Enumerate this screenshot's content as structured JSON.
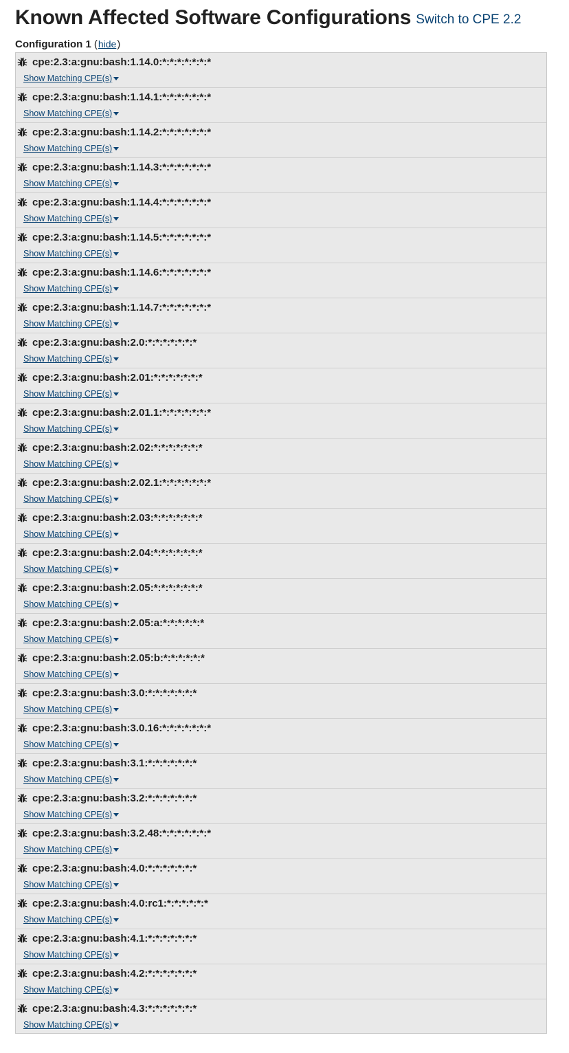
{
  "header": {
    "title": "Known Affected Software Configurations",
    "switch_link": "Switch to CPE 2.2"
  },
  "configuration": {
    "label": "Configuration 1",
    "open_paren": "(",
    "hide_link": "hide",
    "close_paren": ")"
  },
  "icons": {
    "vulnerable": "bug-icon",
    "expand": "caret-down-icon"
  },
  "colors": {
    "link": "#0a4373",
    "row_background": "#e9e9e9",
    "row_border": "#cfcfcf"
  },
  "cpe_items": [
    {
      "cpe": "cpe:2.3:a:gnu:bash:1.14.0:*:*:*:*:*:*:*",
      "match_label": "Show Matching CPE(s)"
    },
    {
      "cpe": "cpe:2.3:a:gnu:bash:1.14.1:*:*:*:*:*:*:*",
      "match_label": "Show Matching CPE(s)"
    },
    {
      "cpe": "cpe:2.3:a:gnu:bash:1.14.2:*:*:*:*:*:*:*",
      "match_label": "Show Matching CPE(s)"
    },
    {
      "cpe": "cpe:2.3:a:gnu:bash:1.14.3:*:*:*:*:*:*:*",
      "match_label": "Show Matching CPE(s)"
    },
    {
      "cpe": "cpe:2.3:a:gnu:bash:1.14.4:*:*:*:*:*:*:*",
      "match_label": "Show Matching CPE(s)"
    },
    {
      "cpe": "cpe:2.3:a:gnu:bash:1.14.5:*:*:*:*:*:*:*",
      "match_label": "Show Matching CPE(s)"
    },
    {
      "cpe": "cpe:2.3:a:gnu:bash:1.14.6:*:*:*:*:*:*:*",
      "match_label": "Show Matching CPE(s)"
    },
    {
      "cpe": "cpe:2.3:a:gnu:bash:1.14.7:*:*:*:*:*:*:*",
      "match_label": "Show Matching CPE(s)"
    },
    {
      "cpe": "cpe:2.3:a:gnu:bash:2.0:*:*:*:*:*:*:*",
      "match_label": "Show Matching CPE(s)"
    },
    {
      "cpe": "cpe:2.3:a:gnu:bash:2.01:*:*:*:*:*:*:*",
      "match_label": "Show Matching CPE(s)"
    },
    {
      "cpe": "cpe:2.3:a:gnu:bash:2.01.1:*:*:*:*:*:*:*",
      "match_label": "Show Matching CPE(s)"
    },
    {
      "cpe": "cpe:2.3:a:gnu:bash:2.02:*:*:*:*:*:*:*",
      "match_label": "Show Matching CPE(s)"
    },
    {
      "cpe": "cpe:2.3:a:gnu:bash:2.02.1:*:*:*:*:*:*:*",
      "match_label": "Show Matching CPE(s)"
    },
    {
      "cpe": "cpe:2.3:a:gnu:bash:2.03:*:*:*:*:*:*:*",
      "match_label": "Show Matching CPE(s)"
    },
    {
      "cpe": "cpe:2.3:a:gnu:bash:2.04:*:*:*:*:*:*:*",
      "match_label": "Show Matching CPE(s)"
    },
    {
      "cpe": "cpe:2.3:a:gnu:bash:2.05:*:*:*:*:*:*:*",
      "match_label": "Show Matching CPE(s)"
    },
    {
      "cpe": "cpe:2.3:a:gnu:bash:2.05:a:*:*:*:*:*:*",
      "match_label": "Show Matching CPE(s)"
    },
    {
      "cpe": "cpe:2.3:a:gnu:bash:2.05:b:*:*:*:*:*:*",
      "match_label": "Show Matching CPE(s)"
    },
    {
      "cpe": "cpe:2.3:a:gnu:bash:3.0:*:*:*:*:*:*:*",
      "match_label": "Show Matching CPE(s)"
    },
    {
      "cpe": "cpe:2.3:a:gnu:bash:3.0.16:*:*:*:*:*:*:*",
      "match_label": "Show Matching CPE(s)"
    },
    {
      "cpe": "cpe:2.3:a:gnu:bash:3.1:*:*:*:*:*:*:*",
      "match_label": "Show Matching CPE(s)"
    },
    {
      "cpe": "cpe:2.3:a:gnu:bash:3.2:*:*:*:*:*:*:*",
      "match_label": "Show Matching CPE(s)"
    },
    {
      "cpe": "cpe:2.3:a:gnu:bash:3.2.48:*:*:*:*:*:*:*",
      "match_label": "Show Matching CPE(s)"
    },
    {
      "cpe": "cpe:2.3:a:gnu:bash:4.0:*:*:*:*:*:*:*",
      "match_label": "Show Matching CPE(s)"
    },
    {
      "cpe": "cpe:2.3:a:gnu:bash:4.0:rc1:*:*:*:*:*:*",
      "match_label": "Show Matching CPE(s)"
    },
    {
      "cpe": "cpe:2.3:a:gnu:bash:4.1:*:*:*:*:*:*:*",
      "match_label": "Show Matching CPE(s)"
    },
    {
      "cpe": "cpe:2.3:a:gnu:bash:4.2:*:*:*:*:*:*:*",
      "match_label": "Show Matching CPE(s)"
    },
    {
      "cpe": "cpe:2.3:a:gnu:bash:4.3:*:*:*:*:*:*:*",
      "match_label": "Show Matching CPE(s)"
    }
  ]
}
